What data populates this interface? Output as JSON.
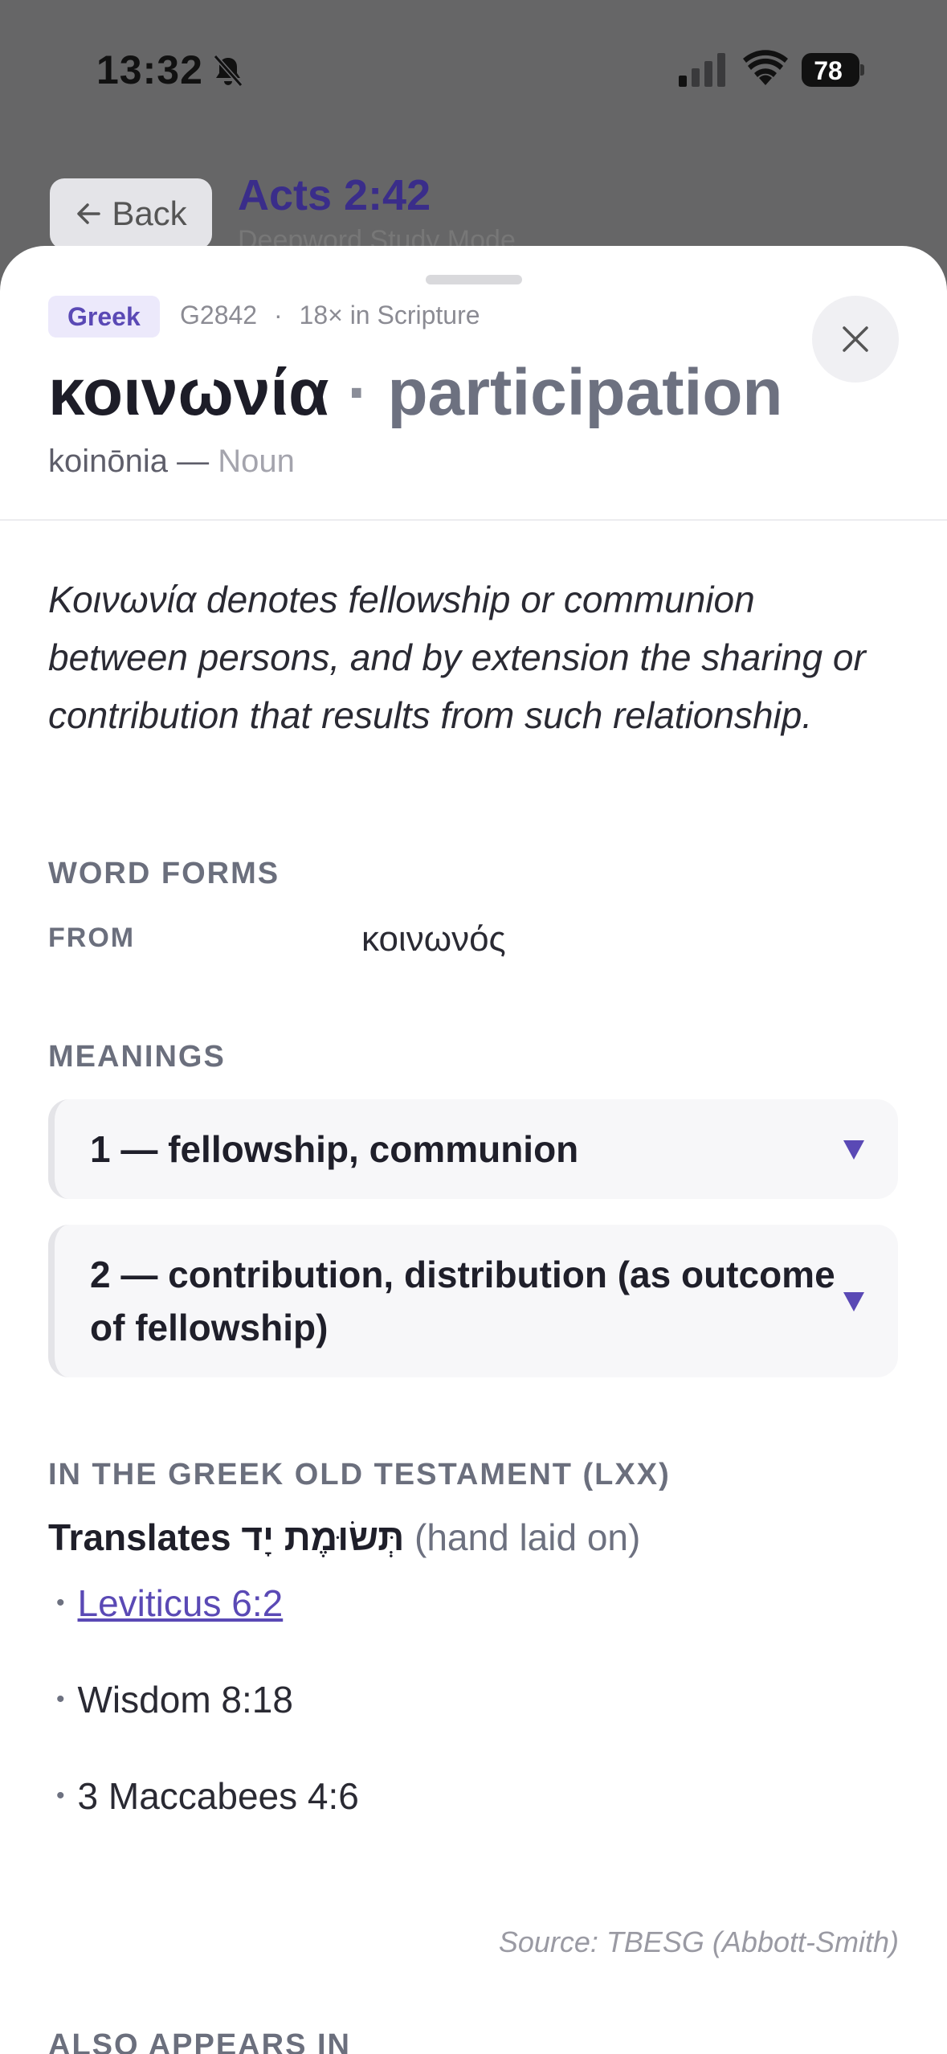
{
  "status_bar": {
    "time": "13:32",
    "battery": "78"
  },
  "nav": {
    "back_label": "Back",
    "title": "Acts 2:42",
    "subtitle": "Deepword Study Mode"
  },
  "entry": {
    "language": "Greek",
    "strongs": "G2842",
    "separator": "·",
    "frequency": "18× in Scripture",
    "lemma": "κοινωνία",
    "lemma_sep": "·",
    "gloss": "participation",
    "transliteration": "koinōnia —",
    "part_of_speech": "Noun",
    "definition": "Κοινωνία denotes fellowship or communion between persons, and by extension the sharing or contribution that results from such relationship."
  },
  "word_forms": {
    "heading": "WORD FORMS",
    "from_label": "FROM",
    "from_value": "κοινωνός"
  },
  "meanings": {
    "heading": "MEANINGS",
    "items": [
      {
        "label": "1 — fellowship, communion"
      },
      {
        "label": "2 — contribution, distribution (as outcome of fellowship)"
      }
    ]
  },
  "lxx": {
    "heading": "IN THE GREEK OLD TESTAMENT (LXX)",
    "translates_label": "Translates",
    "hebrew": "תְּשׂוּמֶת יָד",
    "hebrew_gloss": "(hand laid on)",
    "references": [
      {
        "bullet": "•",
        "label": "Leviticus 6:2"
      },
      {
        "bullet": "•",
        "label": "Wisdom 8:18"
      },
      {
        "bullet": "•",
        "label": "3 Maccabees 4:6"
      }
    ]
  },
  "source": "Source: TBESG (Abbott-Smith)",
  "also_heading": "ALSO APPEARS IN",
  "colors": {
    "accent": "#5a49b5",
    "badge_bg": "#ece9fb",
    "title": "#3a2d8a"
  }
}
